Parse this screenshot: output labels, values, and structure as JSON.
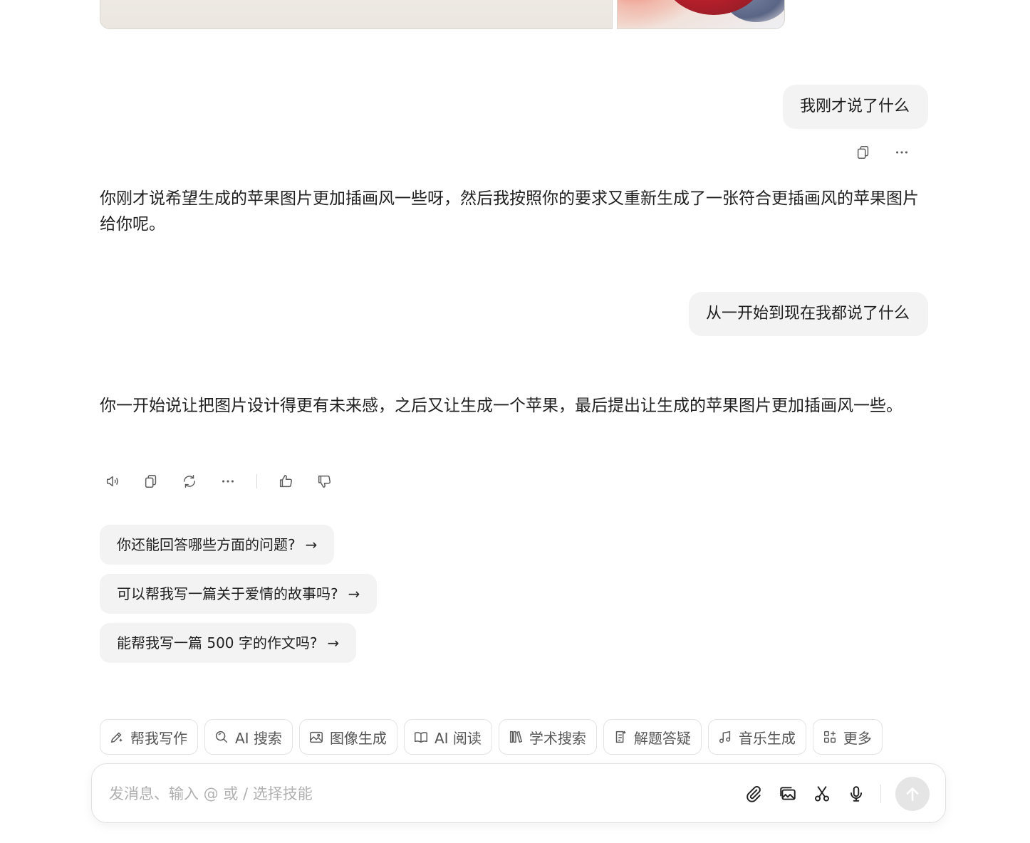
{
  "conversation": {
    "user_messages": [
      "我刚才说了什么",
      "从一开始到现在我都说了什么"
    ],
    "assistant_messages": [
      "你刚才说希望生成的苹果图片更加插画风一些呀，然后我按照你的要求又重新生成了一张符合更插画风的苹果图片给你呢。",
      "你一开始说让把图片设计得更有未来感，之后又让生成一个苹果，最后提出让生成的苹果图片更加插画风一些。"
    ]
  },
  "suggestions": [
    "你还能回答哪些方面的问题?",
    "可以帮我写一篇关于爱情的故事吗?",
    "能帮我写一篇 500 字的作文吗?"
  ],
  "skills": [
    {
      "label": "帮我写作",
      "icon": "pen-sparkle-icon"
    },
    {
      "label": "AI 搜索",
      "icon": "search-icon"
    },
    {
      "label": "图像生成",
      "icon": "image-icon"
    },
    {
      "label": "AI 阅读",
      "icon": "book-icon"
    },
    {
      "label": "学术搜索",
      "icon": "library-icon"
    },
    {
      "label": "解题答疑",
      "icon": "scroll-icon"
    },
    {
      "label": "音乐生成",
      "icon": "music-icon"
    },
    {
      "label": "更多",
      "icon": "apps-icon"
    }
  ],
  "input": {
    "placeholder": "发消息、输入 @ 或 / 选择技能",
    "value": ""
  }
}
